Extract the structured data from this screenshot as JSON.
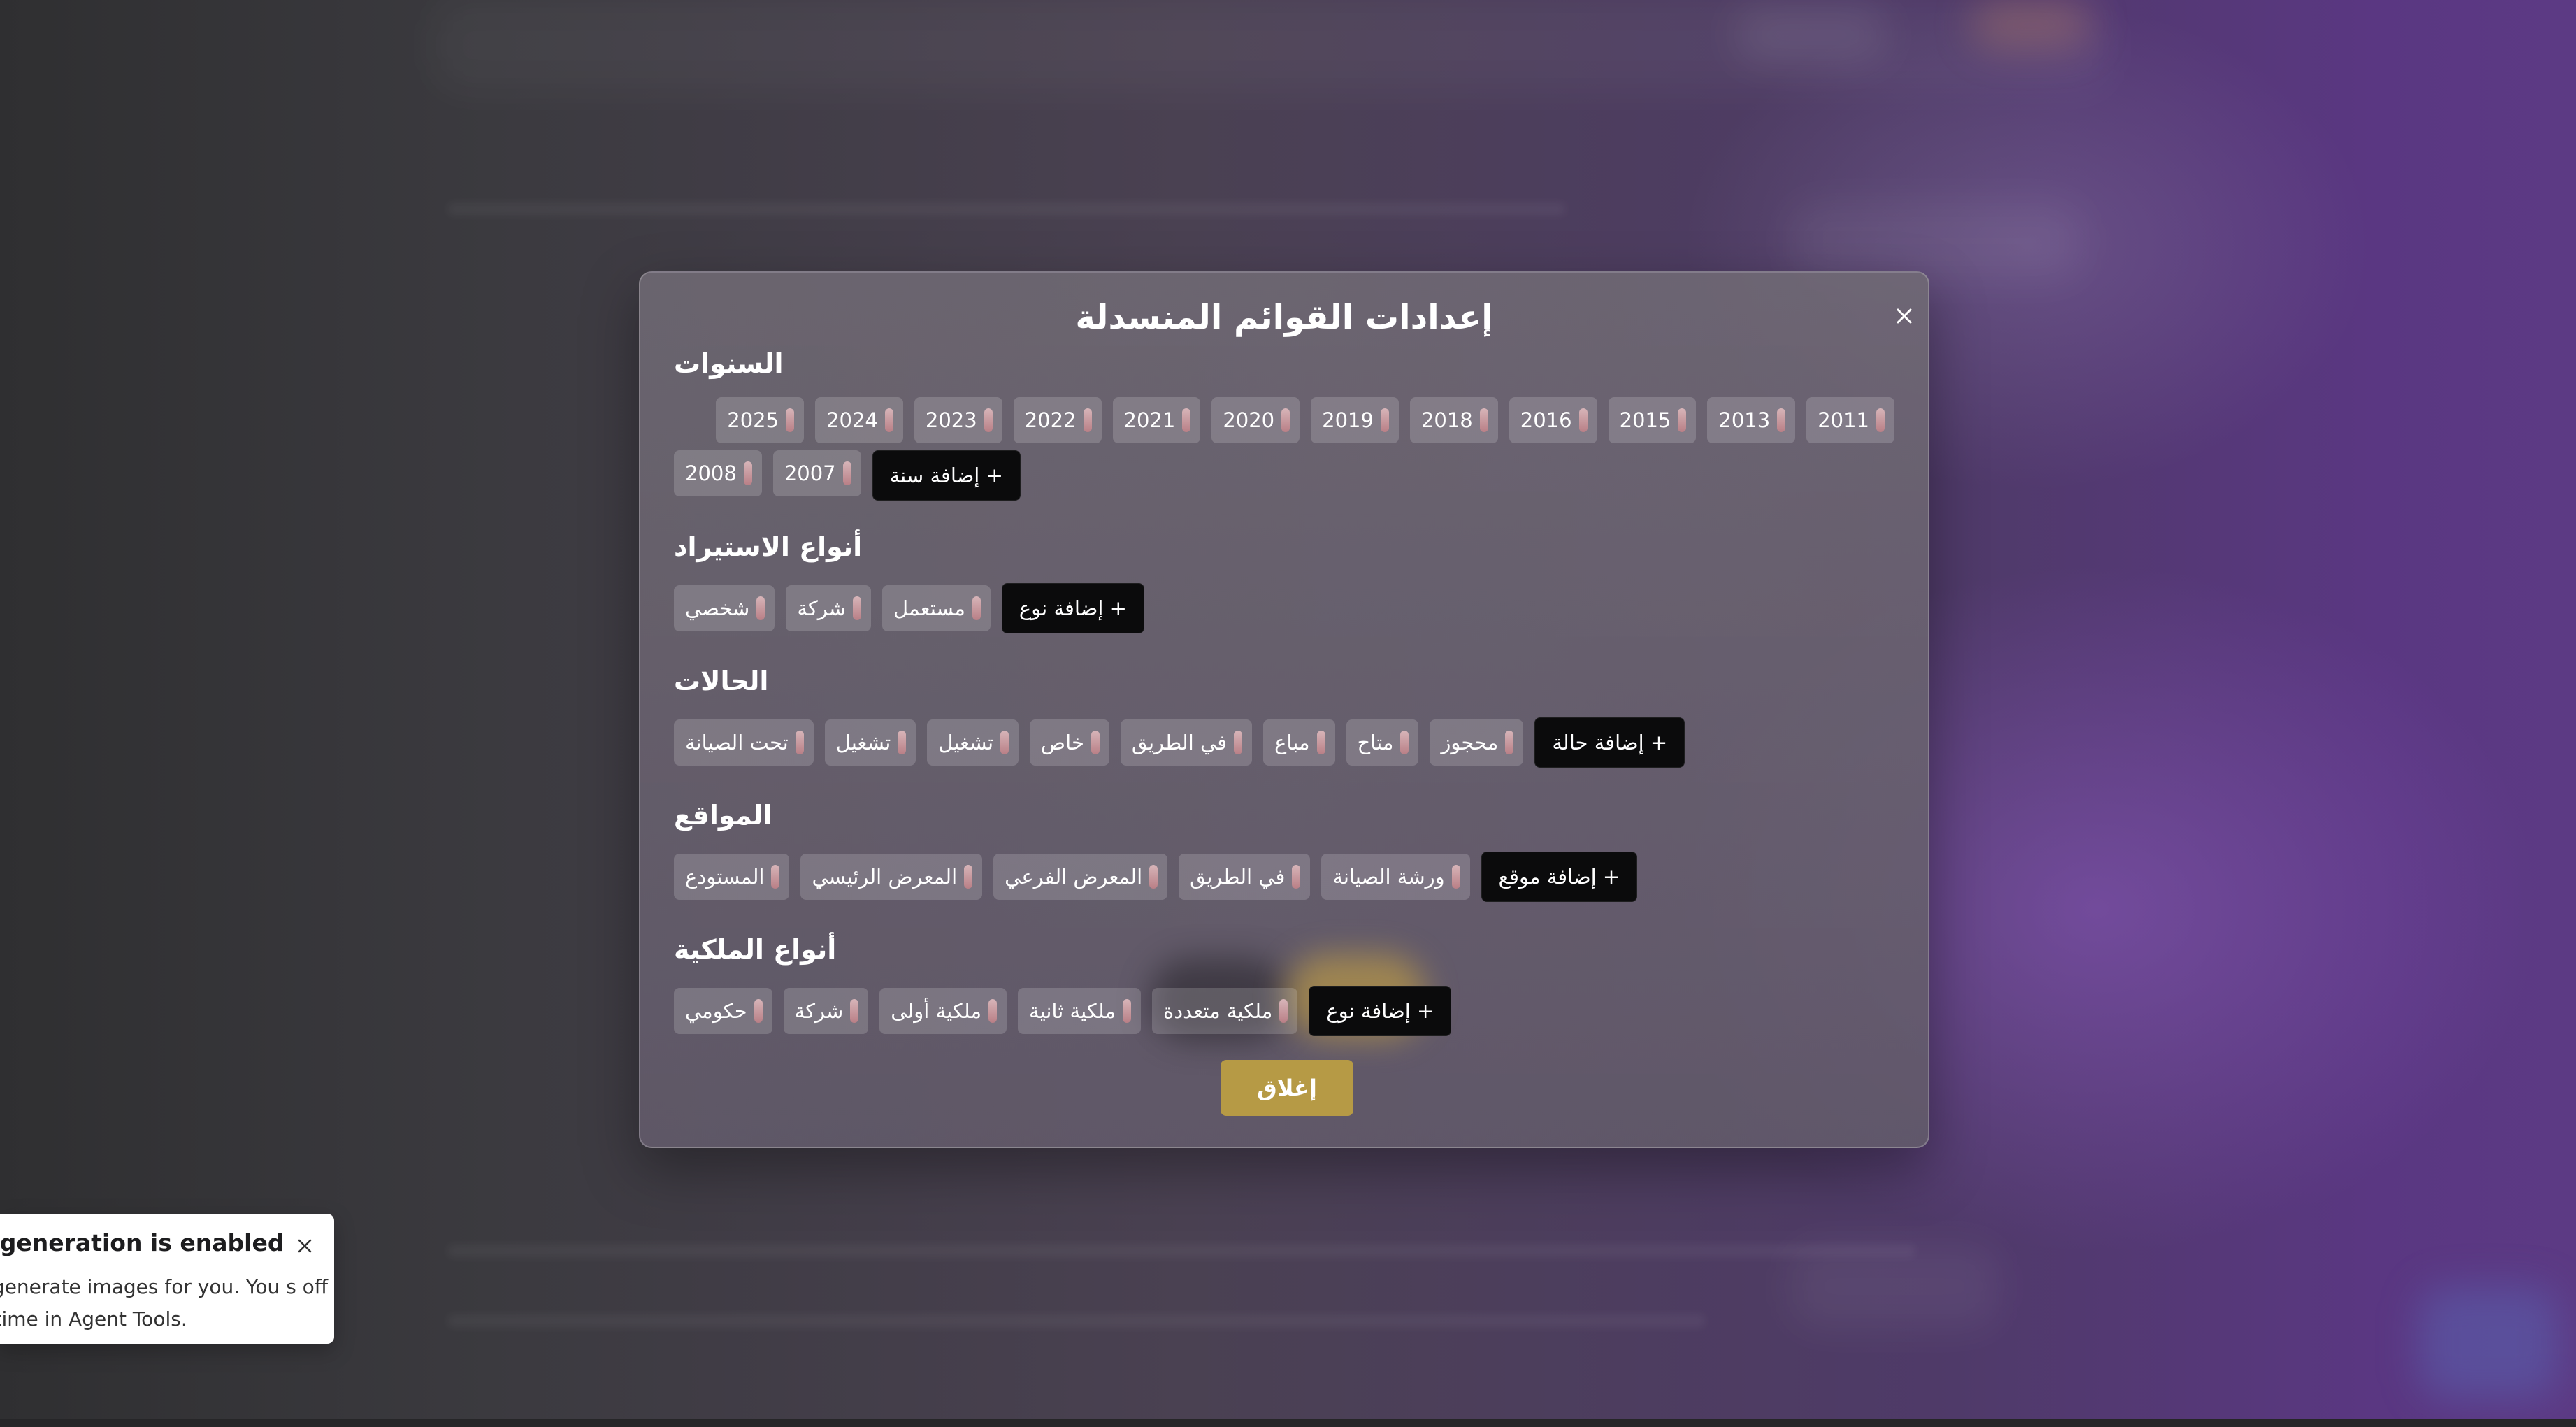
{
  "modal": {
    "title": "إعدادات القوائم المنسدلة",
    "close_button_label": "إغلاق"
  },
  "sections": {
    "years": {
      "title": "السنوات",
      "row1": [
        "2011",
        "2013",
        "2015",
        "2016",
        "2018",
        "2019",
        "2020",
        "2021",
        "2022",
        "2023",
        "2024",
        "2025"
      ],
      "row2": [
        "2007",
        "2008"
      ],
      "add_label": "إضافة سنة +"
    },
    "import_types": {
      "title": "أنواع الاستيراد",
      "items": [
        "مستعمل",
        "شركة",
        "شخصي"
      ],
      "add_label": "إضافة نوع +"
    },
    "statuses": {
      "title": "الحالات",
      "items": [
        "محجوز",
        "متاح",
        "مباع",
        "في الطريق",
        "خاص",
        "تشغيل",
        "تشغيل",
        "تحت الصيانة"
      ],
      "add_label": "إضافة حالة +"
    },
    "locations": {
      "title": "المواقع",
      "items": [
        "ورشة الصيانة",
        "في الطريق",
        "المعرض الفرعي",
        "المعرض الرئيسي",
        "المستودع"
      ],
      "add_label": "إضافة موقع +"
    },
    "ownership_types": {
      "title": "أنواع الملكية",
      "items": [
        "ملكية متعددة",
        "ملكية ثانية",
        "ملكية أولى",
        "شركة",
        "حكومي"
      ],
      "add_label": "إضافة نوع +"
    }
  },
  "toast": {
    "title": "age generation is enabled",
    "body": "ow generate images for you. You s off anytime in Agent Tools."
  },
  "colors": {
    "accent_gold": "#b69a45",
    "add_button_bg": "#0b0b0c",
    "remove_handle": "#c79aa0"
  },
  "icons": {
    "modal_close": "close-icon",
    "toast_close": "close-icon"
  }
}
